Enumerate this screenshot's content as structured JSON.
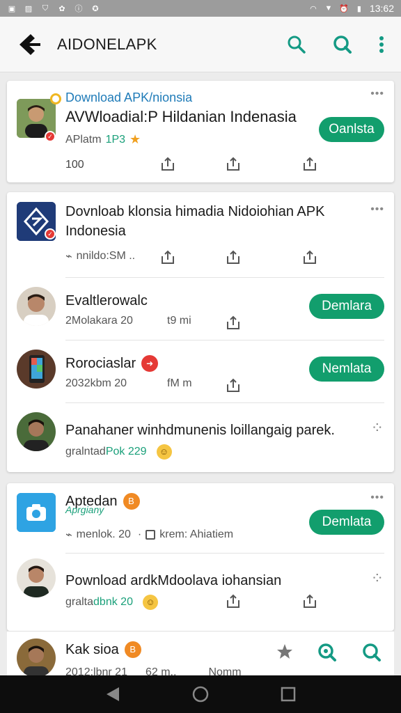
{
  "status_bar": {
    "time": "13:62"
  },
  "app": {
    "title": "AIDONELAPK"
  },
  "card1": {
    "header": "Download APK/nionsia",
    "title": "AVWloadial:P Hildanian Indenasia",
    "meta_prefix": "APlatm",
    "meta_num": "1P3",
    "button": "Oanlsta",
    "count": "100",
    "more": "•••"
  },
  "card2": {
    "item1": {
      "title_line1": "Dovnloab klonsia himadia Nidoiohian APK",
      "title_line2": "Indonesia",
      "meta": "nnildo:SM ..",
      "more": "•••"
    },
    "item2": {
      "title": "Evaltlerowalc",
      "meta1": "2Molakara 20",
      "meta2": "t9 mi",
      "button": "Demlara"
    },
    "item3": {
      "title": "Rorociaslar",
      "meta1": "2032kbm 20",
      "meta2": "fM m",
      "button": "Nemlata"
    },
    "item4": {
      "title": "Panahaner winhdmunenis loillangaig parek.",
      "meta_prefix": "gralntad",
      "meta_green": "Pok 229",
      "more": "⁘"
    }
  },
  "card3": {
    "item1": {
      "title": "Aptedan",
      "subtitle": "Aprgiany",
      "meta1": "menlok. 20",
      "meta2": "krem: Ahiatiem",
      "button": "Demlata",
      "more": "•••"
    },
    "item2": {
      "title": "Pownload ardkMdoolava iohansian",
      "meta_prefix": "gralta",
      "meta_green": "dbnk 20",
      "more": "⁘"
    }
  },
  "bottom": {
    "title": "Kak sioa",
    "meta1": "2012:lbnr 21",
    "meta2": "62 m..",
    "meta3": "Nomm"
  },
  "colors": {
    "accent": "#129e6d",
    "teal_icon": "#149a84",
    "blue_text": "#1f7bb8"
  }
}
